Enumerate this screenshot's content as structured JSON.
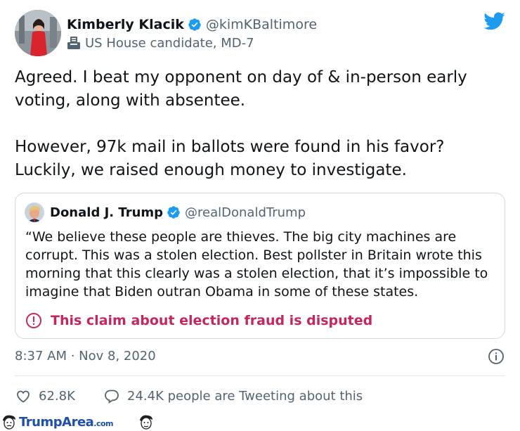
{
  "tweet": {
    "author": {
      "name": "Kimberly Klacik",
      "handle": "@kimKBaltimore",
      "label": "US House candidate, MD-7"
    },
    "text": "Agreed. I beat my opponent on day of & in-person early voting, along with absentee.\n\nHowever, 97k mail in ballots were found in his favor? Luckily, we raised enough money to investigate.",
    "quoted": {
      "name": "Donald J. Trump",
      "handle": "@realDonaldTrump",
      "text": "“We believe these people are thieves. The big city machines are corrupt. This was a stolen election. Best pollster in Britain wrote this morning that this clearly was a stolen election, that it’s impossible to imagine that Biden outran Obama in some of these states.",
      "disputed_label": "This claim about election fraud is disputed"
    },
    "timestamp": "8:37 AM · Nov 8, 2020",
    "likes": "62.8K",
    "retweets_text": "24.4K people are Tweeting about this"
  },
  "watermark": {
    "text": "TrumpArea",
    "suffix": ".com"
  },
  "colors": {
    "brand": "#1d9bf0",
    "text": "#0f1419",
    "muted": "#536471",
    "disputed": "#c4265f",
    "border": "#cfd9de"
  },
  "icons": {
    "verified": "verified-badge-icon",
    "label": "ballot-box-icon",
    "logo": "twitter-bird-icon",
    "disputed": "exclamation-circle-icon",
    "info": "info-icon",
    "like": "heart-icon",
    "reply": "speech-bubble-icon"
  }
}
